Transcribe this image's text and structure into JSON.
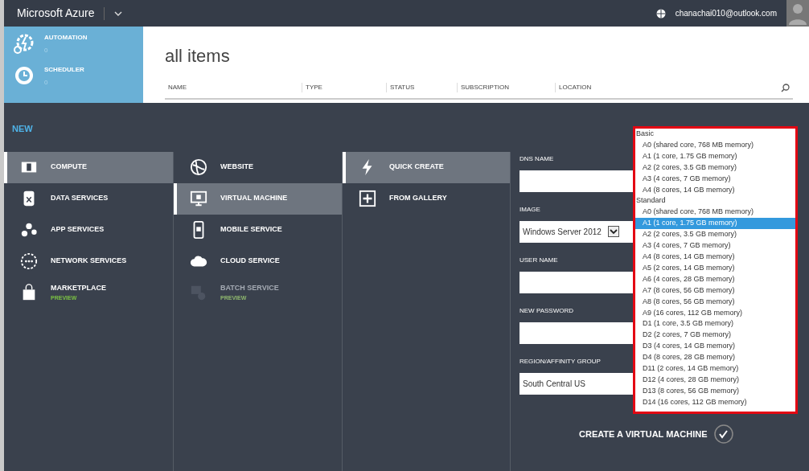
{
  "top_bar": {
    "brand": "Microsoft Azure",
    "account": "chanachai010@outlook.com"
  },
  "side_tiles": [
    {
      "label": "AUTOMATION",
      "count": "0"
    },
    {
      "label": "SCHEDULER",
      "count": "0"
    }
  ],
  "list": {
    "title": "all items",
    "columns": [
      "NAME",
      "TYPE",
      "STATUS",
      "SUBSCRIPTION",
      "LOCATION"
    ]
  },
  "new_panel": {
    "title": "NEW",
    "categories": [
      {
        "label": "COMPUTE",
        "selected": true
      },
      {
        "label": "DATA SERVICES",
        "selected": false
      },
      {
        "label": "APP SERVICES",
        "selected": false
      },
      {
        "label": "NETWORK SERVICES",
        "selected": false
      },
      {
        "label": "MARKETPLACE",
        "badge": "PREVIEW",
        "selected": false
      }
    ],
    "services": [
      {
        "label": "WEBSITE",
        "selected": false,
        "disabled": false
      },
      {
        "label": "VIRTUAL MACHINE",
        "selected": true,
        "disabled": false
      },
      {
        "label": "MOBILE SERVICE",
        "selected": false,
        "disabled": false
      },
      {
        "label": "CLOUD SERVICE",
        "selected": false,
        "disabled": false
      },
      {
        "label": "BATCH SERVICE",
        "badge": "PREVIEW",
        "selected": false,
        "disabled": true
      }
    ],
    "methods": [
      {
        "label": "QUICK CREATE",
        "selected": true
      },
      {
        "label": "FROM GALLERY",
        "selected": false
      }
    ],
    "form": [
      {
        "label": "DNS NAME",
        "kind": "text"
      },
      {
        "label": "IMAGE",
        "kind": "select",
        "value": "Windows Server 2012"
      },
      {
        "label": "USER NAME",
        "kind": "text"
      },
      {
        "label": "NEW PASSWORD",
        "kind": "text"
      },
      {
        "label": "REGION/AFFINITY GROUP",
        "kind": "select",
        "value": "South Central US"
      }
    ],
    "size_dropdown": [
      {
        "group": "Basic",
        "options": [
          {
            "label": "A0 (shared core, 768 MB memory)",
            "selected": false
          },
          {
            "label": "A1 (1 core, 1.75 GB memory)",
            "selected": false
          },
          {
            "label": "A2 (2 cores, 3.5 GB memory)",
            "selected": false
          },
          {
            "label": "A3 (4 cores, 7 GB memory)",
            "selected": false
          },
          {
            "label": "A4 (8 cores, 14 GB memory)",
            "selected": false
          }
        ]
      },
      {
        "group": "Standard",
        "options": [
          {
            "label": "A0 (shared core, 768 MB memory)",
            "selected": false
          },
          {
            "label": "A1 (1 core, 1.75 GB memory)",
            "selected": true
          },
          {
            "label": "A2 (2 cores, 3.5 GB memory)",
            "selected": false
          },
          {
            "label": "A3 (4 cores, 7 GB memory)",
            "selected": false
          },
          {
            "label": "A4 (8 cores, 14 GB memory)",
            "selected": false
          },
          {
            "label": "A5 (2 cores, 14 GB memory)",
            "selected": false
          },
          {
            "label": "A6 (4 cores, 28 GB memory)",
            "selected": false
          },
          {
            "label": "A7 (8 cores, 56 GB memory)",
            "selected": false
          },
          {
            "label": "A8 (8 cores, 56 GB memory)",
            "selected": false
          },
          {
            "label": "A9 (16 cores, 112 GB memory)",
            "selected": false
          },
          {
            "label": "D1 (1 core, 3.5 GB memory)",
            "selected": false
          },
          {
            "label": "D2 (2 cores, 7 GB memory)",
            "selected": false
          },
          {
            "label": "D3 (4 cores, 14 GB memory)",
            "selected": false
          },
          {
            "label": "D4 (8 cores, 28 GB memory)",
            "selected": false
          },
          {
            "label": "D11 (2 cores, 14 GB memory)",
            "selected": false
          },
          {
            "label": "D12 (4 cores, 28 GB memory)",
            "selected": false
          },
          {
            "label": "D13 (8 cores, 56 GB memory)",
            "selected": false
          },
          {
            "label": "D14 (16 cores, 112 GB memory)",
            "selected": false
          }
        ]
      }
    ],
    "submit": "CREATE A VIRTUAL MACHINE"
  }
}
